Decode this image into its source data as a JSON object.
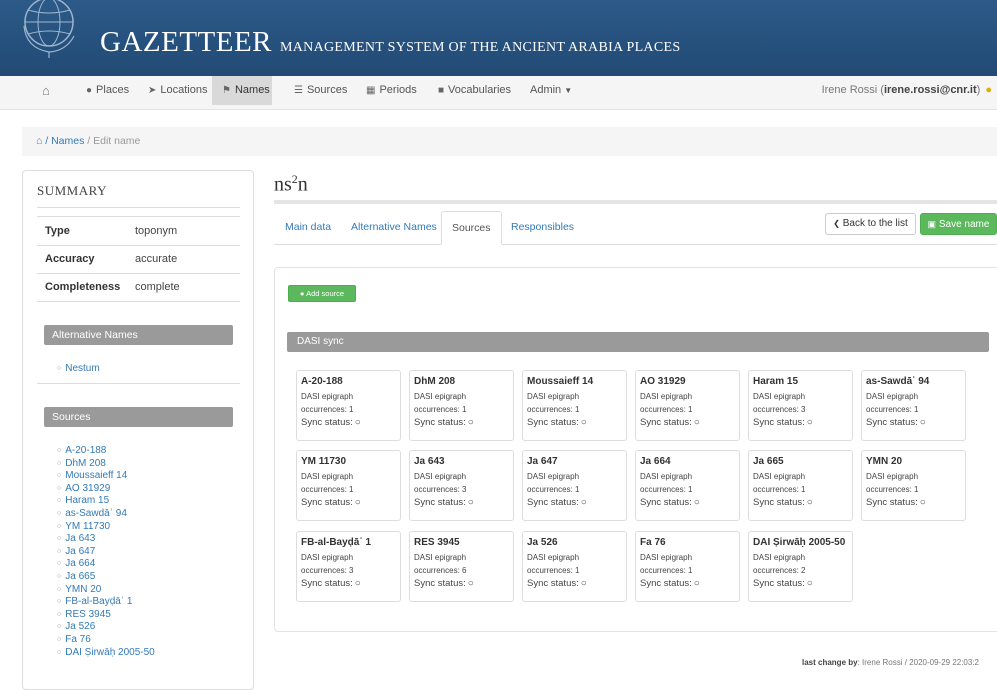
{
  "header": {
    "title_big": "GAZETTEER",
    "title_small": "MANAGEMENT SYSTEM OF THE ANCIENT ARABIA PLACES"
  },
  "nav": {
    "items": [
      {
        "label": "",
        "icon": "home-icon"
      },
      {
        "label": "Places",
        "icon": "map-marker-icon"
      },
      {
        "label": "Locations",
        "icon": "location-arrow-icon"
      },
      {
        "label": "Names",
        "icon": "tags-icon"
      },
      {
        "label": "Sources",
        "icon": "list-icon"
      },
      {
        "label": "Periods",
        "icon": "calendar-icon"
      },
      {
        "label": "Vocabularies",
        "icon": "book-icon"
      },
      {
        "label": "Admin",
        "icon": "caret-down-icon"
      }
    ],
    "active": "Names",
    "user_name": "Irene Rossi",
    "user_email": "irene.rossi@cnr.it"
  },
  "breadcrumb": {
    "link": "/ Names",
    "current": "/ Edit name"
  },
  "summary": {
    "title": "SUMMARY",
    "rows": [
      {
        "key": "Type",
        "value": "toponym"
      },
      {
        "key": "Accuracy",
        "value": "accurate"
      },
      {
        "key": "Completeness",
        "value": "complete"
      }
    ],
    "alt_heading": "Alternative Names",
    "alt_names": [
      "Nestum"
    ],
    "sources_heading": "Sources",
    "sources": [
      "A-20-188",
      "DhM 208",
      "Moussaieff 14",
      "AO 31929",
      "Haram 15",
      "as-Sawdāʾ 94",
      "YM 11730",
      "Ja 643",
      "Ja 647",
      "Ja 664",
      "Ja 665",
      "YMN 20",
      "FB-al-Bayḍāʾ 1",
      "RES 3945",
      "Ja 526",
      "Fa 76",
      "DAI Ṣirwāḥ 2005-50"
    ]
  },
  "page": {
    "title_main": "ns",
    "title_sup": "2",
    "title_tail": "n",
    "tabs": [
      "Main data",
      "Alternative Names",
      "Sources",
      "Responsibles"
    ],
    "active_tab": "Sources",
    "back_label": "Back to the list",
    "save_label": "Save name",
    "add_source_label": "Add source",
    "dasi_heading": "DASI sync",
    "sync_symbol": "○",
    "cards": [
      {
        "name": "A-20-188",
        "type": "DASI epigraph",
        "occurrences": "occurrences: 1",
        "status": "Sync status:"
      },
      {
        "name": "DhM 208",
        "type": "DASI epigraph",
        "occurrences": "occurrences: 1",
        "status": "Sync status:"
      },
      {
        "name": "Moussaieff 14",
        "type": "DASI epigraph",
        "occurrences": "occurrences: 1",
        "status": "Sync status:"
      },
      {
        "name": "AO 31929",
        "type": "DASI epigraph",
        "occurrences": "occurrences: 1",
        "status": "Sync status:"
      },
      {
        "name": "Haram 15",
        "type": "DASI epigraph",
        "occurrences": "occurrences: 3",
        "status": "Sync status:"
      },
      {
        "name": "as-Sawdāʾ 94",
        "type": "DASI epigraph",
        "occurrences": "occurrences: 1",
        "status": "Sync status:"
      },
      {
        "name": "YM 11730",
        "type": "DASI epigraph",
        "occurrences": "occurrences: 1",
        "status": "Sync status:"
      },
      {
        "name": "Ja 643",
        "type": "DASI epigraph",
        "occurrences": "occurrences: 3",
        "status": "Sync status:"
      },
      {
        "name": "Ja 647",
        "type": "DASI epigraph",
        "occurrences": "occurrences: 1",
        "status": "Sync status:"
      },
      {
        "name": "Ja 664",
        "type": "DASI epigraph",
        "occurrences": "occurrences: 1",
        "status": "Sync status:"
      },
      {
        "name": "Ja 665",
        "type": "DASI epigraph",
        "occurrences": "occurrences: 1",
        "status": "Sync status:"
      },
      {
        "name": "YMN 20",
        "type": "DASI epigraph",
        "occurrences": "occurrences: 1",
        "status": "Sync status:"
      },
      {
        "name": "FB-al-Bayḍāʾ 1",
        "type": "DASI epigraph",
        "occurrences": "occurrences: 3",
        "status": "Sync status:"
      },
      {
        "name": "RES 3945",
        "type": "DASI epigraph",
        "occurrences": "occurrences: 6",
        "status": "Sync status:"
      },
      {
        "name": "Ja 526",
        "type": "DASI epigraph",
        "occurrences": "occurrences: 1",
        "status": "Sync status:"
      },
      {
        "name": "Fa 76",
        "type": "DASI epigraph",
        "occurrences": "occurrences: 1",
        "status": "Sync status:"
      },
      {
        "name": "DAI Ṣirwāḥ 2005-50",
        "type": "DASI epigraph",
        "occurrences": "occurrences: 2",
        "status": "Sync status:"
      }
    ],
    "last_change_label": "last change",
    "last_change_value": ": Irene Rossi / 2020-09-29 22:03:2"
  },
  "colors": {
    "banner": "#2c5a88",
    "link": "#337ab7",
    "success": "#5cb85c",
    "section": "#9a9a9a"
  }
}
